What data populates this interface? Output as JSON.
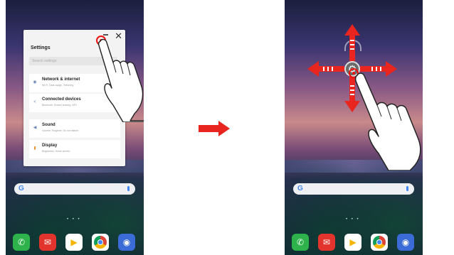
{
  "left_screen": {
    "widget": {
      "title": "Settings",
      "search_placeholder": "Search settings",
      "close_glyph": "✕",
      "items": [
        {
          "label": "Network & internet",
          "sub": "Wi-Fi, Data usage, Tethering",
          "icon": "wifi-icon"
        },
        {
          "label": "Connected devices",
          "sub": "Bluetooth, Screen sharing, NFC",
          "icon": "share-icon"
        },
        {
          "label": "Sound",
          "sub": "Volume, Ringtone, Do not disturb",
          "icon": "volume-icon"
        },
        {
          "label": "Display",
          "sub": "Brightness, Home screen",
          "icon": "display-icon"
        }
      ]
    },
    "search_bar": {
      "logo": "G"
    },
    "dock": [
      "phone-icon",
      "messages-icon",
      "play-store-icon",
      "chrome-icon",
      "camera-icon"
    ]
  },
  "transition_arrow": {
    "color": "#e8251e"
  },
  "right_screen": {
    "search_bar": {
      "logo": "G"
    },
    "gear_glyph": "⚙",
    "dock": [
      "phone-icon",
      "messages-icon",
      "play-store-icon",
      "chrome-icon",
      "camera-icon"
    ],
    "arrow_color": "#e8251e"
  }
}
